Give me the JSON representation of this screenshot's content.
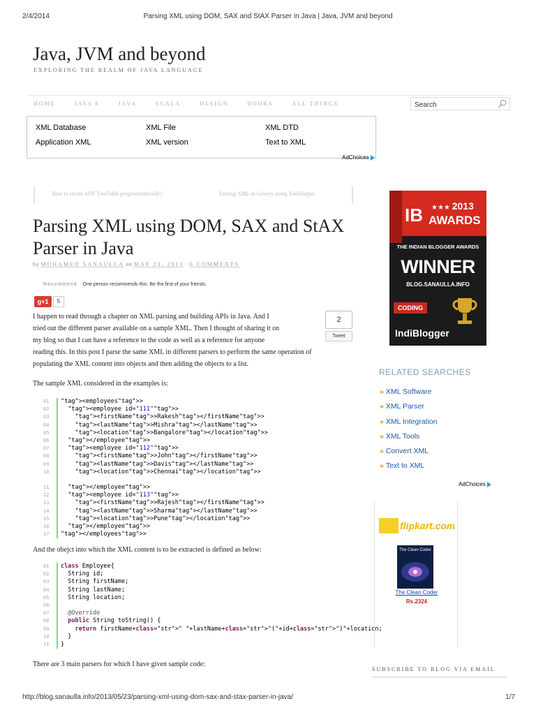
{
  "print_header": {
    "date": "2/4/2014",
    "title": "Parsing XML using DOM, SAX and StAX Parser in Java | Java, JVM and beyond"
  },
  "print_footer": {
    "url": "http://blog.sanaulla.info/2013/05/23/parsing-xml-using-dom-sax-and-stax-parser-in-java/",
    "page": "1/7"
  },
  "site": {
    "title": "Java, JVM and beyond",
    "tagline": "EXPLORING THE REALM OF JAVA LANGUAGE"
  },
  "nav": {
    "items": [
      "HOME",
      "JAVA 8",
      "JAVA",
      "SCALA",
      "DESIGN",
      "BOOKS",
      "ALL THINGS"
    ]
  },
  "search": {
    "placeholder": "Search",
    "icon": "search-icon"
  },
  "ad_top": {
    "links": [
      "XML Database",
      "XML File",
      "XML DTD",
      "Application XML",
      "XML version",
      "Text to XML"
    ],
    "adchoices": "AdChoices"
  },
  "post_nav": {
    "prev": "How to create ADF TreeTable programmatically?",
    "next": "Parsing XML in Groovy using XmlSlurper"
  },
  "post": {
    "title": "Parsing XML using DOM, SAX and StAX Parser in Java",
    "by": "by",
    "author": "MOHAMED SANAULLA",
    "on": "on",
    "date": "MAY 23, 2013",
    "sep": "·",
    "comments": "6 COMMENTS"
  },
  "social": {
    "recommend_label": "Recommend",
    "recommend_text": "One person recommends this. Be the first of your friends.",
    "gplus_label": "g+1",
    "gplus_count": "5",
    "tweet_count": "2",
    "tweet_label": "Tweet"
  },
  "body": {
    "p1": [
      "I happen to read through a chapter on XML parsing and building APIs in Java. And I",
      "tried out the different parser available on a sample XML. Then I thought of sharing it on",
      "my blog so that I can have a reference to the code as well as a reference for anyone",
      "reading this. In this post I parse the same XML in different parsers to perform the same operation of",
      "populating the XML content into objects and then adding the objects to a list."
    ],
    "p2": "The sample XML considered in the examples is:",
    "p3": "And the obejct into which the XML content is to be extracted is defined as below:",
    "p4": "There are 3 main parsers for which I have given sample code:"
  },
  "xml_code": [
    {
      "ln": "01",
      "text": "<employees>"
    },
    {
      "ln": "02",
      "text": "  <employee id=\"111\">"
    },
    {
      "ln": "03",
      "text": "    <firstName>Rakesh</firstName>"
    },
    {
      "ln": "04",
      "text": "    <lastName>Mishra</lastName>"
    },
    {
      "ln": "05",
      "text": "    <location>Bangalore</location>"
    },
    {
      "ln": "06",
      "text": "  </employee>"
    },
    {
      "ln": "07",
      "text": "  <employee id=\"112\">"
    },
    {
      "ln": "08",
      "text": "    <firstName>John</firstName>"
    },
    {
      "ln": "09",
      "text": "    <lastName>Davis</lastName>"
    },
    {
      "ln": "10",
      "text": "    <location>Chennai</location>"
    },
    {
      "ln": "",
      "text": ""
    },
    {
      "ln": "11",
      "text": "  </employee>"
    },
    {
      "ln": "12",
      "text": "  <employee id=\"113\">"
    },
    {
      "ln": "13",
      "text": "    <firstName>Rajesh</firstName>"
    },
    {
      "ln": "14",
      "text": "    <lastName>Sharma</lastName>"
    },
    {
      "ln": "15",
      "text": "    <location>Pune</location>"
    },
    {
      "ln": "16",
      "text": "  </employee>"
    },
    {
      "ln": "17",
      "text": "</employees>"
    }
  ],
  "java_code": [
    {
      "ln": "01",
      "text": "class Employee{"
    },
    {
      "ln": "02",
      "text": "  String id;"
    },
    {
      "ln": "03",
      "text": "  String firstName;"
    },
    {
      "ln": "04",
      "text": "  String lastName;"
    },
    {
      "ln": "05",
      "text": "  String location;"
    },
    {
      "ln": "06",
      "text": ""
    },
    {
      "ln": "07",
      "text": "  @Override"
    },
    {
      "ln": "08",
      "text": "  public String toString() {"
    },
    {
      "ln": "09",
      "text": "    return firstName+\" \"+lastName+\"(\"+id+\")\"+location;"
    },
    {
      "ln": "10",
      "text": "  }"
    },
    {
      "ln": "11",
      "text": "}"
    }
  ],
  "badge": {
    "year": "2013",
    "stars": "★★★",
    "logo": "IB",
    "awards": "AWARDS",
    "subtitle": "THE INDIAN BLOGGER AWARDS",
    "winner": "WINNER",
    "blog": "BLOG.SANAULLA.INFO",
    "category": "CODING",
    "brand": "IndiBlogger"
  },
  "related": {
    "title": "RELATED SEARCHES",
    "arrow": "»",
    "items": [
      "XML Software",
      "XML Parser",
      "XML Integration",
      "XML Tools",
      "Convert XML",
      "Text to XML"
    ],
    "adchoices": "AdChoices"
  },
  "side_ad": {
    "logo": "flipkart.com",
    "book_cover_title": "The Clean Coder",
    "book_title": "The Clean Coder",
    "price": "Rs.2324"
  },
  "subscribe": {
    "title": "SUBSCRIBE TO BLOG VIA EMAIL"
  },
  "colors": {
    "accent_link": "#1a5aa8",
    "gplus": "#d73d32",
    "badge_red": "#d42a1f",
    "code_gutter": "#6ce26c"
  }
}
